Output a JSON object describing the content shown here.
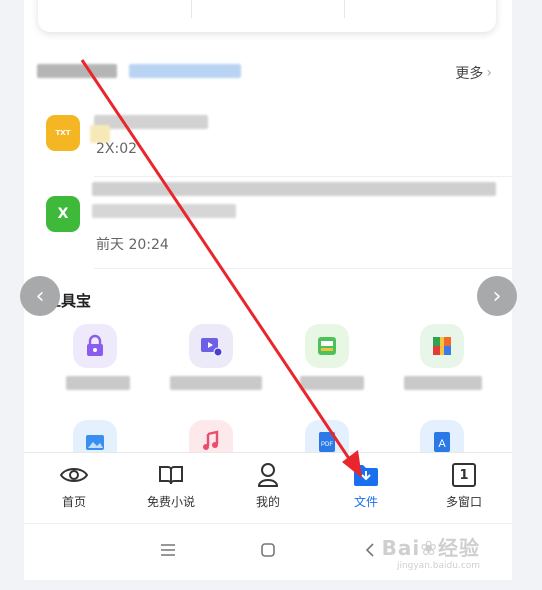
{
  "recent": {
    "more_label": "更多",
    "files": [
      {
        "icon": "txt-file-icon",
        "icon_text": "TXT",
        "time": "2X:02"
      },
      {
        "icon": "excel-file-icon",
        "icon_text": "X",
        "time": "前天 20:24"
      }
    ]
  },
  "toolbox": {
    "title": "工具宝",
    "tools": [
      {
        "icon": "lock-icon"
      },
      {
        "icon": "video-convert-icon"
      },
      {
        "icon": "green-doc-icon"
      },
      {
        "icon": "archive-icon"
      },
      {
        "icon": "image-icon"
      },
      {
        "icon": "music-icon"
      },
      {
        "icon": "pdf-icon",
        "icon_text": "PDF"
      },
      {
        "icon": "text-image-icon",
        "icon_text": "A"
      }
    ]
  },
  "tabbar": {
    "tabs": [
      {
        "label": "首页",
        "icon": "eye-icon"
      },
      {
        "label": "免费小说",
        "icon": "book-icon"
      },
      {
        "label": "我的",
        "icon": "person-icon"
      },
      {
        "label": "文件",
        "icon": "download-folder-icon",
        "active": true
      },
      {
        "label": "多窗口",
        "icon": "window-count-icon",
        "count": "1"
      }
    ]
  },
  "watermark": {
    "line1": "Bai❀经验",
    "line2": "jingyan.baidu.com"
  },
  "colors": {
    "accent": "#1a6ff0",
    "arrow": "#e8262b"
  }
}
